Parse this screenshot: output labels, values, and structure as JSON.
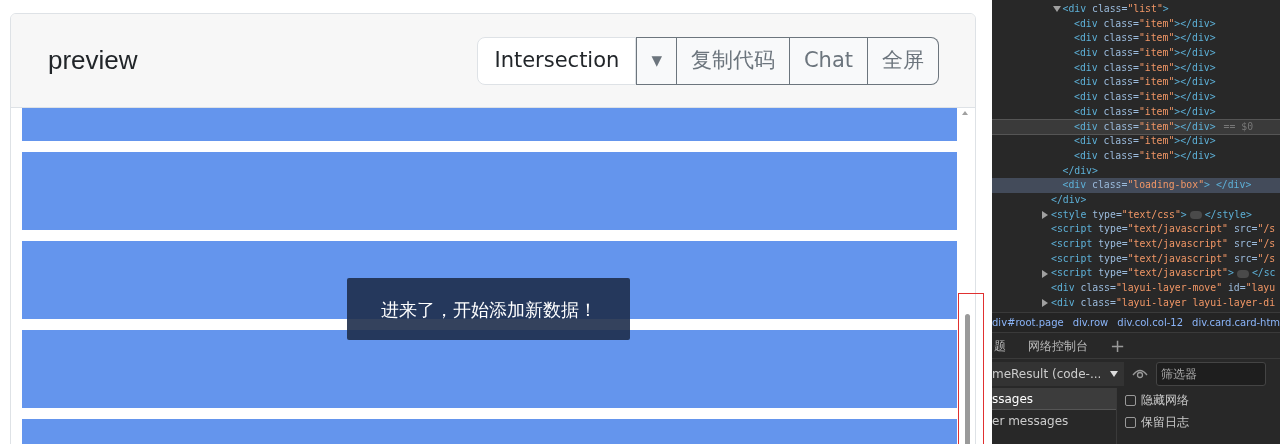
{
  "card": {
    "title": "preview",
    "buttons": [
      {
        "label": "Intersection",
        "kind": "primary"
      },
      {
        "label": "▾",
        "kind": "caret"
      },
      {
        "label": "复制代码",
        "kind": "outline"
      },
      {
        "label": "Chat",
        "kind": "outline"
      },
      {
        "label": "全屏",
        "kind": "outline"
      }
    ],
    "items": [
      {
        "kind": "block"
      },
      {
        "kind": "block"
      },
      {
        "kind": "block"
      },
      {
        "kind": "block"
      },
      {
        "kind": "block"
      }
    ],
    "toast": "进来了，开始添加新数据！"
  },
  "devtools": {
    "dom": [
      {
        "close": "</div>",
        "children": [
          {
            "text": "<div class=\"list\">",
            "expanded": true,
            "selected": false,
            "highlighted": false,
            "close": "</div>",
            "children": [
              {
                "text": "<div class=\"item\"></div>",
                "selected": false,
                "highlighted": false
              },
              {
                "text": "<div class=\"item\"></div>",
                "selected": false,
                "highlighted": false
              },
              {
                "text": "<div class=\"item\"></div>",
                "selected": false,
                "highlighted": false
              },
              {
                "text": "<div class=\"item\"></div>",
                "selected": false,
                "highlighted": false
              },
              {
                "text": "<div class=\"item\"></div>",
                "selected": false,
                "highlighted": false
              },
              {
                "text": "<div class=\"item\"></div>",
                "selected": false,
                "highlighted": false
              },
              {
                "text": "<div class=\"item\"></div>",
                "selected": false,
                "highlighted": false
              },
              {
                "text": "<div class=\"item\"></div>",
                "selected": true,
                "highlighted": false,
                "suffix": "== $0"
              },
              {
                "text": "<div class=\"item\"></div>",
                "selected": false,
                "highlighted": false
              },
              {
                "text": "<div class=\"item\"></div>",
                "selected": false,
                "highlighted": false
              }
            ]
          },
          {
            "text": "<div class=\"loading-box\"> </div>",
            "selected": false,
            "highlighted": true
          }
        ]
      },
      {
        "text": "<style type=\"text/css\">",
        "expanded": false,
        "end": "</style>",
        "selected": false,
        "highlighted": false
      },
      {
        "text": "<script type=\"text/javascript\" src=\"/s",
        "selected": false,
        "highlighted": false
      },
      {
        "text": "<script type=\"text/javascript\" src=\"/s",
        "selected": false,
        "highlighted": false
      },
      {
        "text": "<script type=\"text/javascript\" src=\"/s",
        "selected": false,
        "highlighted": false
      },
      {
        "text": "<script type=\"text/javascript\">",
        "expanded": false,
        "end": "</sc",
        "selected": false,
        "highlighted": false
      },
      {
        "text": "<div class=\"layui-layer-move\" id=\"layu",
        "selected": false,
        "highlighted": false
      },
      {
        "text": "<div class=\"layui-layer layui-layer-di",
        "expanded": false,
        "selected": false,
        "highlighted": false
      }
    ],
    "breadcrumbs": [
      "div#root.page",
      "div.row",
      "div.col.col-12",
      "div.card.card-htm"
    ],
    "tabs": [
      {
        "label": "题",
        "selected": false
      },
      {
        "label": "网络控制台",
        "selected": false
      }
    ],
    "add_tab": "+",
    "context": "meResult (code-...",
    "filter_placeholder": "筛选器",
    "sidebar": [
      {
        "label": "ssages",
        "selected": true
      },
      {
        "label": "er messages",
        "selected": false
      }
    ],
    "options": [
      {
        "label": "隐藏网络",
        "checked": false
      },
      {
        "label": "保留日志",
        "checked": false
      }
    ]
  }
}
